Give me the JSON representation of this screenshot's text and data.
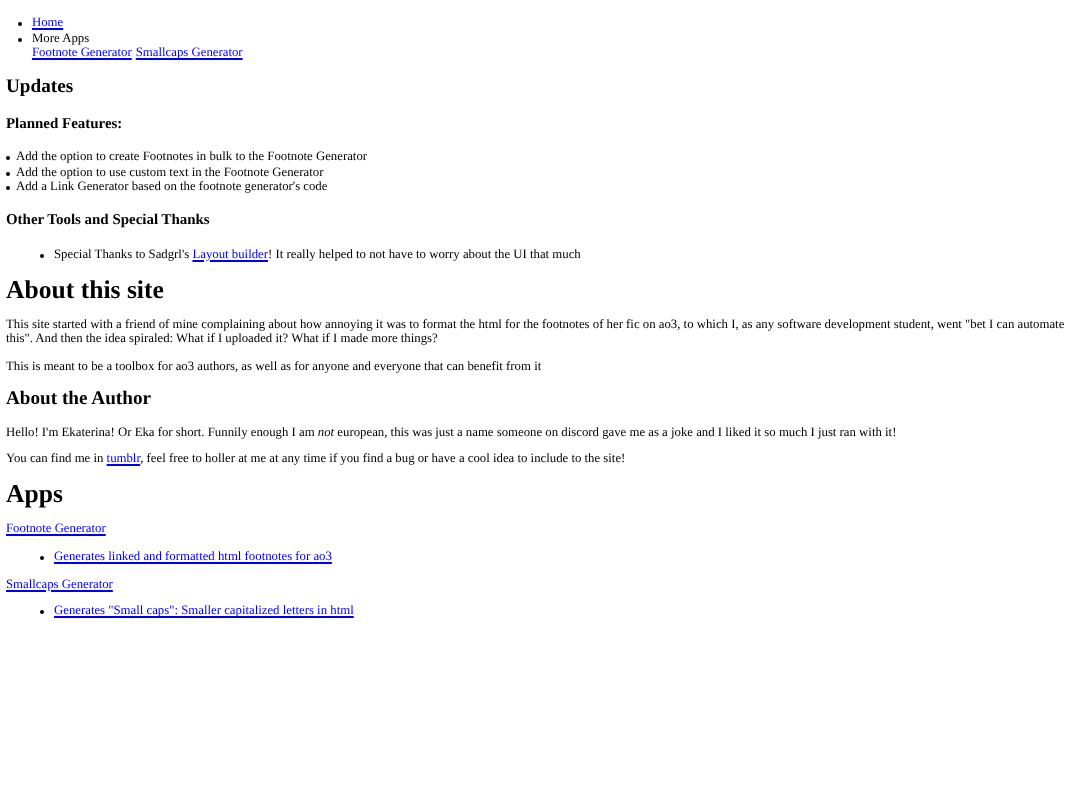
{
  "nav": {
    "items": [
      {
        "kind": "link",
        "label": "Home"
      },
      {
        "kind": "text",
        "label": "More Apps",
        "links": [
          "Footnote Generator",
          "Smallcaps Generator"
        ]
      }
    ]
  },
  "updates": {
    "heading": "Updates",
    "planned": {
      "heading": "Planned Features:",
      "items": [
        "Add the option to create Footnotes in bulk to the Footnote Generator",
        "Add the option to use custom text in the Footnote Generator",
        "Add a Link Generator based on the footnote generator's code"
      ]
    },
    "thanks": {
      "heading": "Other Tools and Special Thanks",
      "items": [
        [
          {
            "kind": "text",
            "text": "Special Thanks to Sadgrl's "
          },
          {
            "kind": "link",
            "text": "Layout builder"
          },
          {
            "kind": "text",
            "text": "! It really helped to not have to worry about the UI that much"
          }
        ]
      ]
    }
  },
  "about": {
    "heading": "About this site",
    "paragraphs": [
      [
        {
          "kind": "text",
          "text": "This site started with a friend of mine complaining about how annoying it was to format the html for the footnotes of her fic on ao3, to which I, as any software development student, went \"bet I can automate this\". And then the idea spiraled: What if I uploaded it? What if I made more things?"
        }
      ],
      [
        {
          "kind": "text",
          "text": "This is meant to be a toolbox for ao3 authors, as well as for anyone and everyone that can benefit from it"
        }
      ]
    ]
  },
  "author": {
    "heading": "About the Author",
    "paragraphs": [
      [
        {
          "kind": "text",
          "text": "Hello! I'm Ekaterina! Or Eka for short. Funnily enough I am *not* european, this was just a name someone on discord gave me as a joke and I liked it so much I just ran with it!"
        }
      ],
      [
        {
          "kind": "text",
          "text": "You can find me in "
        },
        {
          "kind": "link",
          "text": "tumblr"
        },
        {
          "kind": "text",
          "text": ", feel free to holler at me at any time if you find a bug or have a cool idea to include to the site!"
        }
      ]
    ]
  },
  "apps": {
    "heading": "Apps",
    "entries": [
      {
        "link": "Footnote Generator",
        "items": [
          "Generates linked and formatted html footnotes for ao3"
        ]
      },
      {
        "link": "Smallcaps Generator",
        "items": [
          "Generates \"Small caps\": Smaller capitalized letters in html"
        ]
      }
    ]
  }
}
